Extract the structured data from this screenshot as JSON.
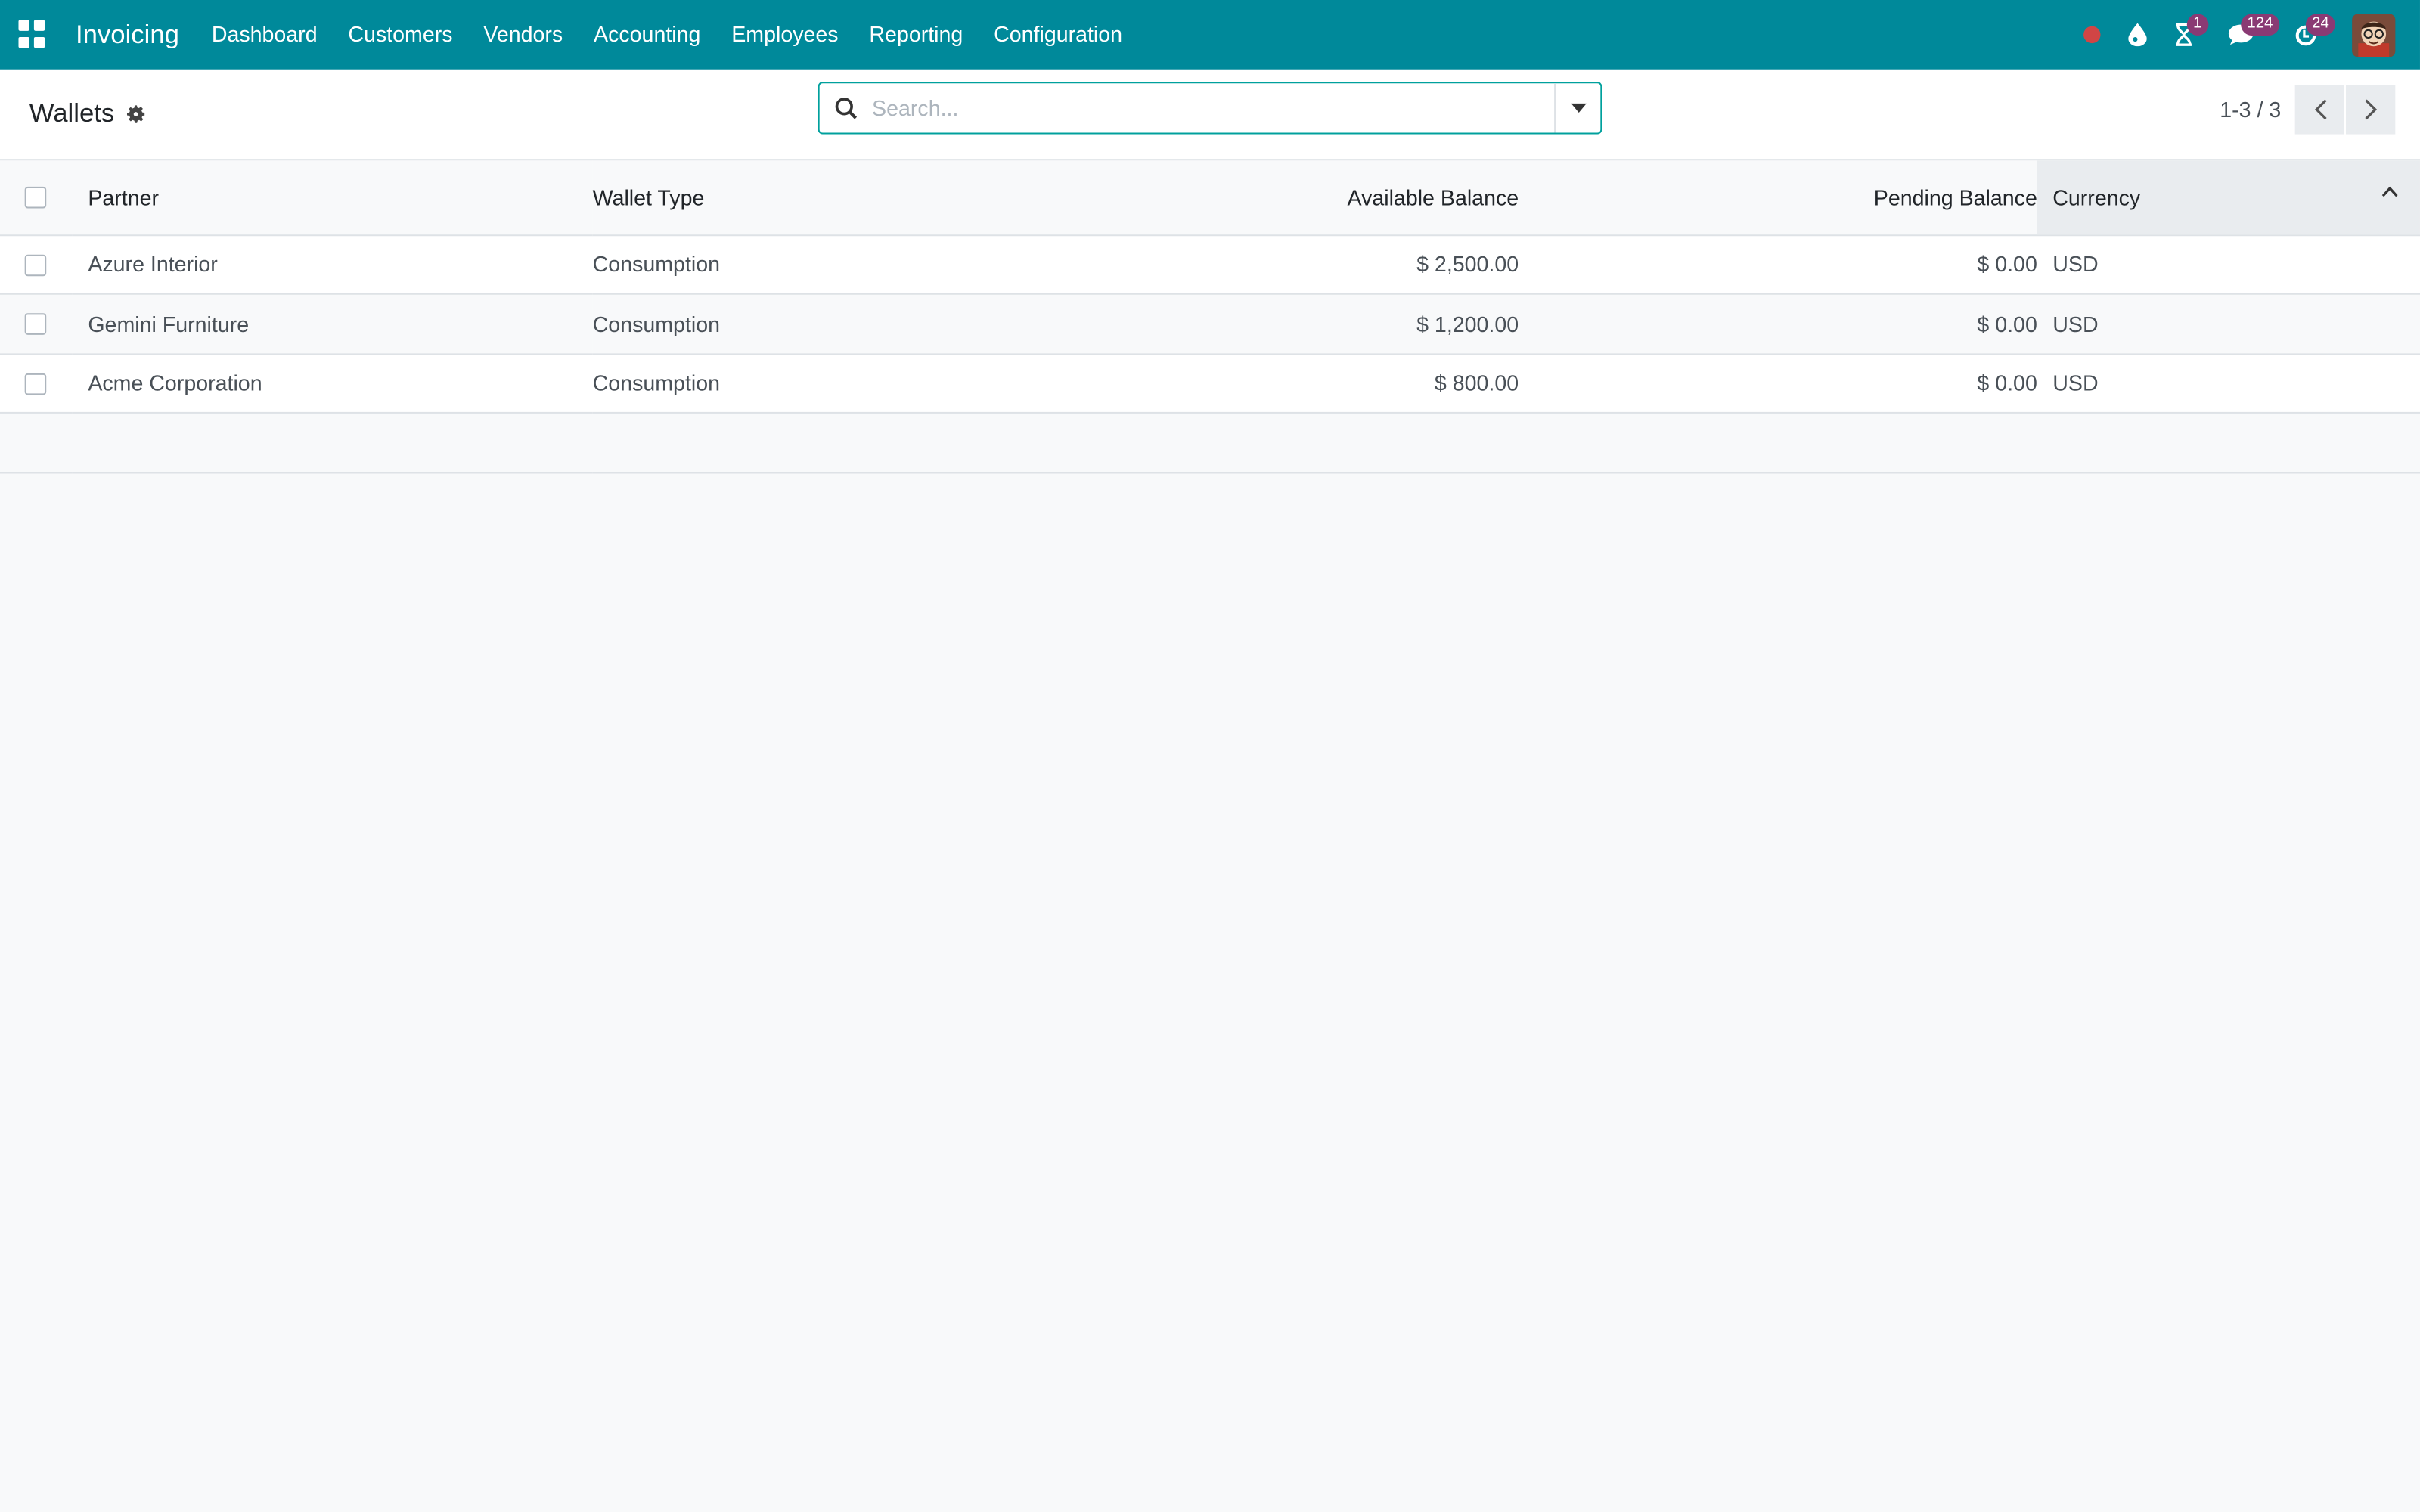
{
  "navbar": {
    "app_name": "Invoicing",
    "menu": [
      "Dashboard",
      "Customers",
      "Vendors",
      "Accounting",
      "Employees",
      "Reporting",
      "Configuration"
    ],
    "badges": {
      "activity": "1",
      "messages": "124",
      "updates": "24"
    }
  },
  "control_panel": {
    "title": "Wallets",
    "search_placeholder": "Search...",
    "pager": "1-3 / 3"
  },
  "table": {
    "headers": {
      "partner": "Partner",
      "wallet_type": "Wallet Type",
      "available_balance": "Available Balance",
      "pending_balance": "Pending Balance",
      "currency": "Currency"
    },
    "rows": [
      {
        "partner": "Azure Interior",
        "wallet_type": "Consumption",
        "available_balance": "$ 2,500.00",
        "pending_balance": "$ 0.00",
        "currency": "USD"
      },
      {
        "partner": "Gemini Furniture",
        "wallet_type": "Consumption",
        "available_balance": "$ 1,200.00",
        "pending_balance": "$ 0.00",
        "currency": "USD"
      },
      {
        "partner": "Acme Corporation",
        "wallet_type": "Consumption",
        "available_balance": "$ 800.00",
        "pending_balance": "$ 0.00",
        "currency": "USD"
      }
    ]
  },
  "colors": {
    "navbar": "#00899a",
    "badge": "#8a3a74",
    "recording_dot": "#d04545"
  }
}
